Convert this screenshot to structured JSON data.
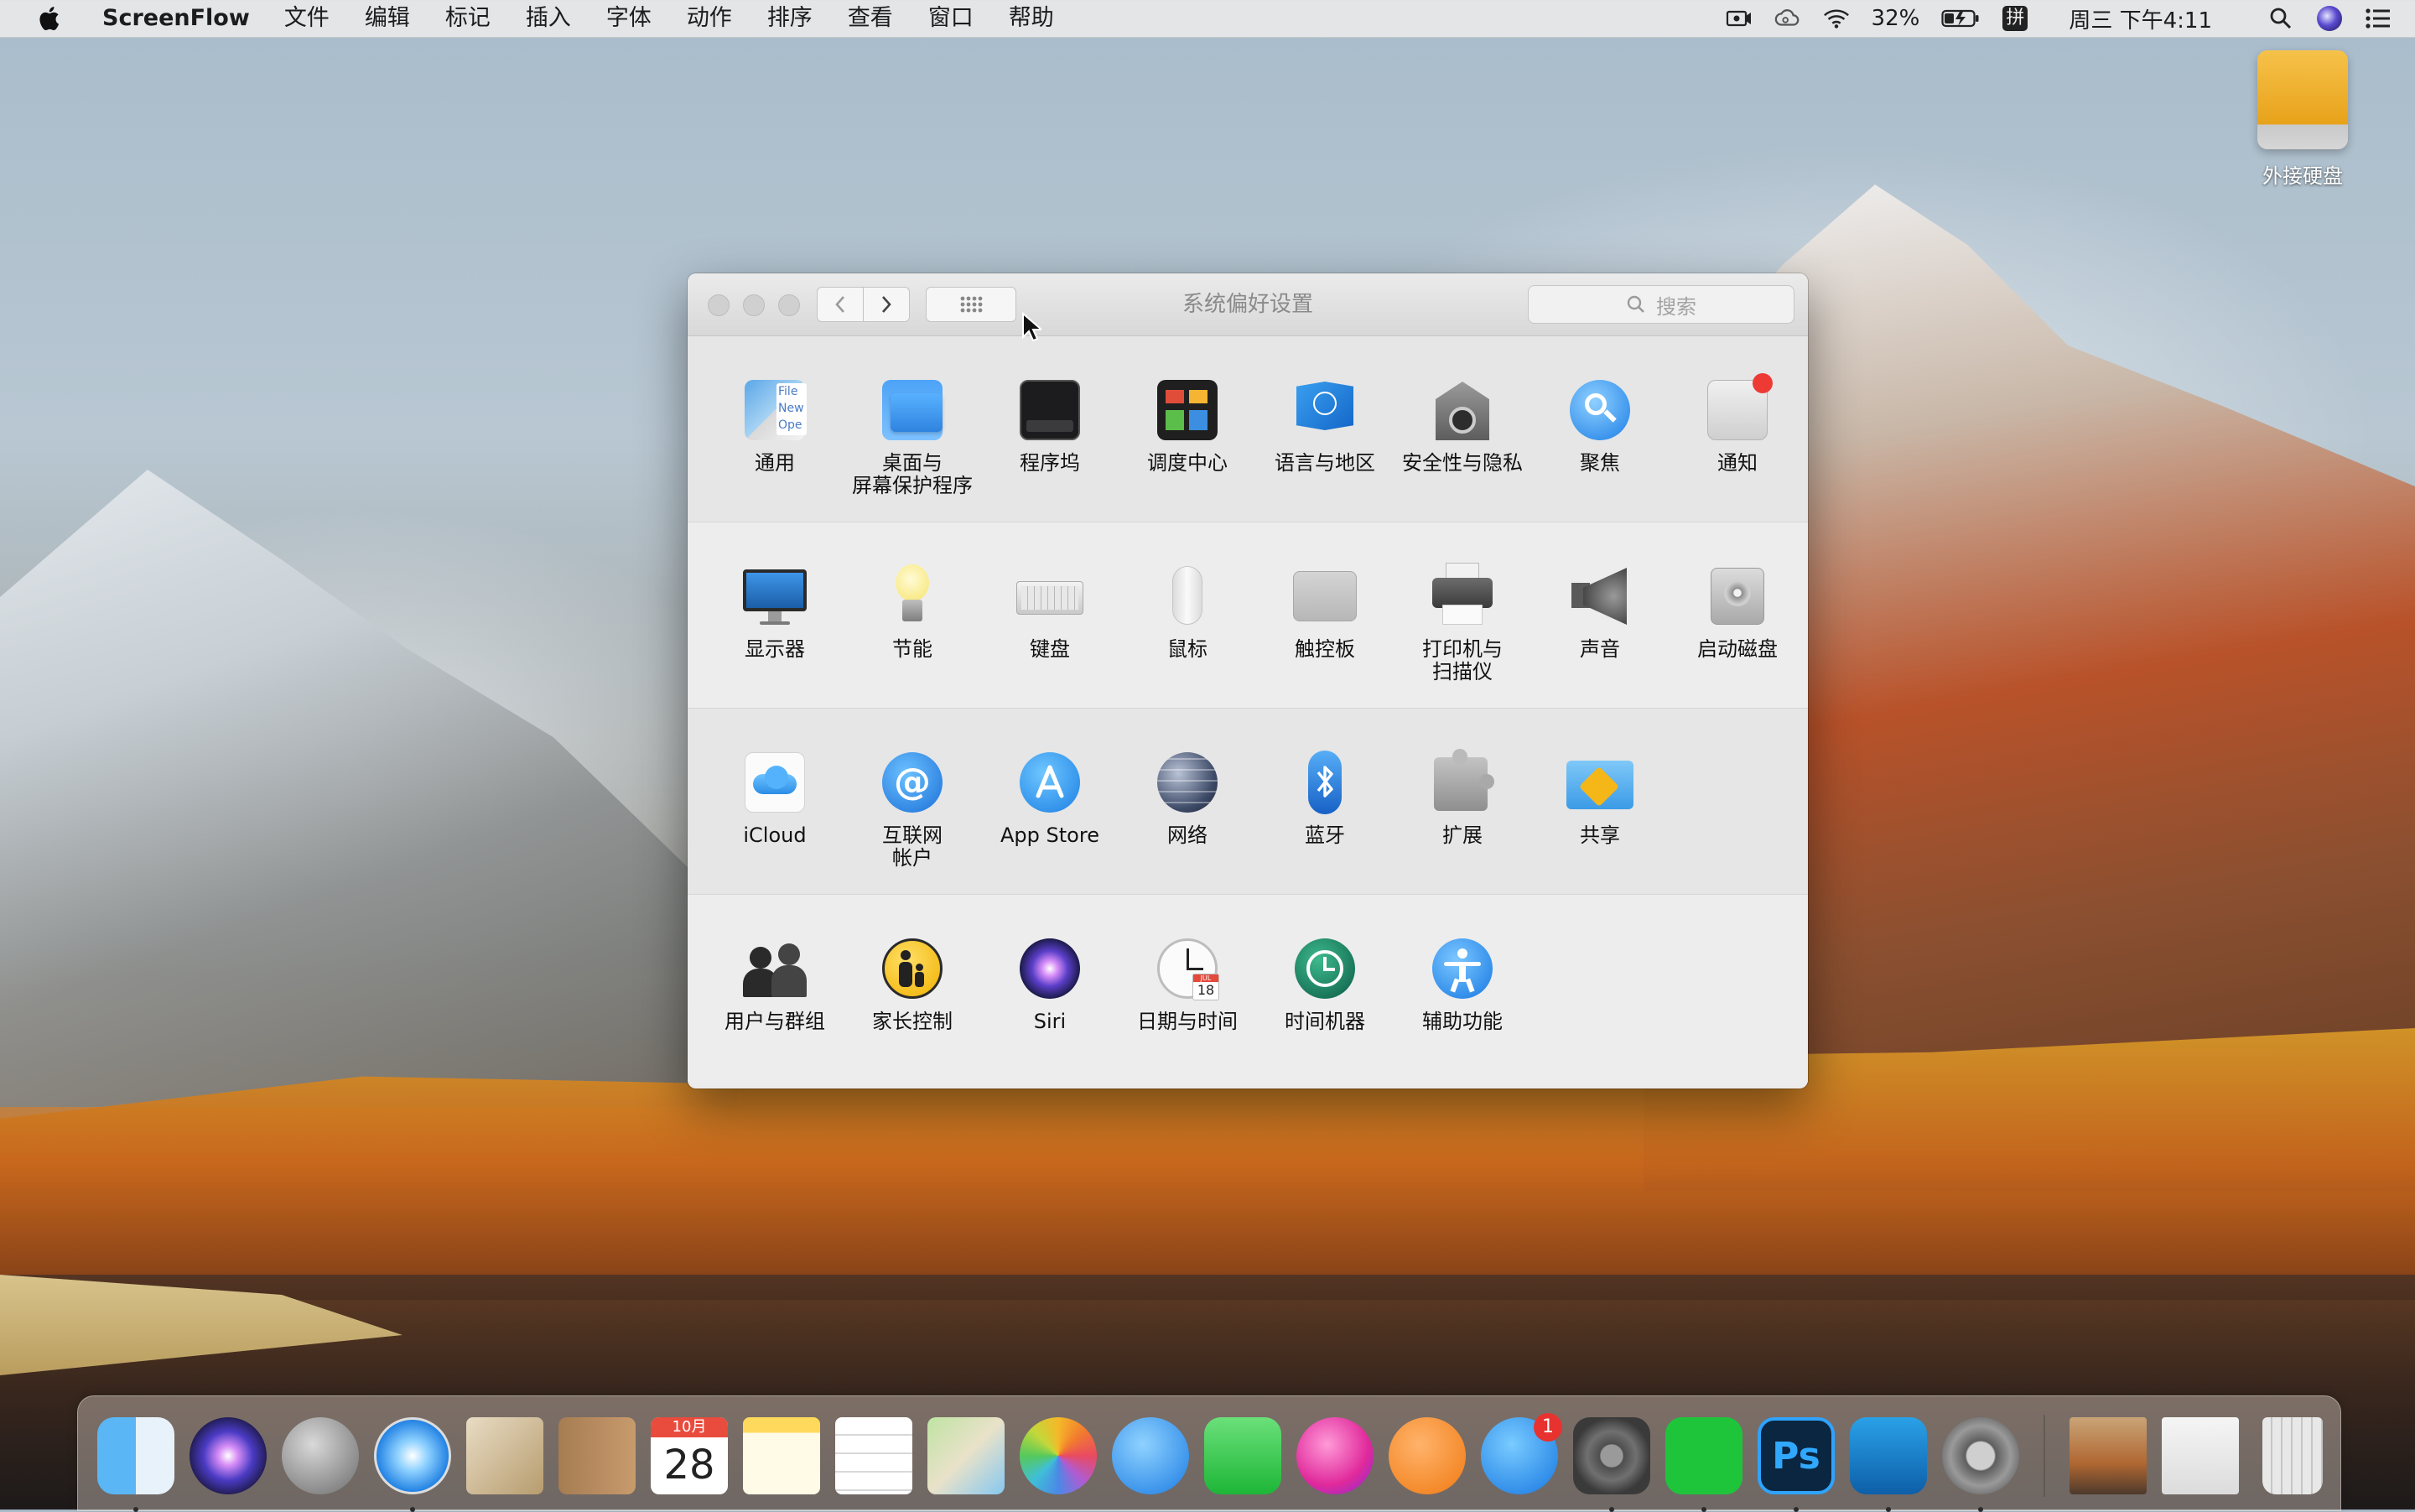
{
  "menubar": {
    "app_name": "ScreenFlow",
    "menus": [
      "文件",
      "编辑",
      "标记",
      "插入",
      "字体",
      "动作",
      "排序",
      "查看",
      "窗口",
      "帮助"
    ],
    "battery_percent": "32%",
    "input_method": "拼",
    "clock": "周三 下午4:11",
    "status_icons": [
      "screen-record-icon",
      "creative-cloud-icon",
      "wifi-icon",
      "battery-icon",
      "input-method-icon",
      "spotlight-icon",
      "siri-icon",
      "notification-center-icon"
    ]
  },
  "desktop": {
    "drive_label": "外接硬盘"
  },
  "window": {
    "title": "系统偏好设置",
    "search_placeholder": "搜索",
    "rows": [
      [
        {
          "label": "通用",
          "icon": "general-icon"
        },
        {
          "label": "桌面与\n屏幕保护程序",
          "icon": "desktop-screensaver-icon"
        },
        {
          "label": "程序坞",
          "icon": "dock-icon"
        },
        {
          "label": "调度中心",
          "icon": "mission-control-icon"
        },
        {
          "label": "语言与地区",
          "icon": "language-region-icon"
        },
        {
          "label": "安全性与隐私",
          "icon": "security-privacy-icon"
        },
        {
          "label": "聚焦",
          "icon": "spotlight-icon"
        },
        {
          "label": "通知",
          "icon": "notifications-icon"
        }
      ],
      [
        {
          "label": "显示器",
          "icon": "displays-icon"
        },
        {
          "label": "节能",
          "icon": "energy-saver-icon"
        },
        {
          "label": "键盘",
          "icon": "keyboard-icon"
        },
        {
          "label": "鼠标",
          "icon": "mouse-icon"
        },
        {
          "label": "触控板",
          "icon": "trackpad-icon"
        },
        {
          "label": "打印机与\n扫描仪",
          "icon": "printers-scanners-icon"
        },
        {
          "label": "声音",
          "icon": "sound-icon"
        },
        {
          "label": "启动磁盘",
          "icon": "startup-disk-icon"
        }
      ],
      [
        {
          "label": "iCloud",
          "icon": "icloud-icon"
        },
        {
          "label": "互联网\n帐户",
          "icon": "internet-accounts-icon"
        },
        {
          "label": "App Store",
          "icon": "app-store-icon"
        },
        {
          "label": "网络",
          "icon": "network-icon"
        },
        {
          "label": "蓝牙",
          "icon": "bluetooth-icon"
        },
        {
          "label": "扩展",
          "icon": "extensions-icon"
        },
        {
          "label": "共享",
          "icon": "sharing-icon"
        }
      ],
      [
        {
          "label": "用户与群组",
          "icon": "users-groups-icon"
        },
        {
          "label": "家长控制",
          "icon": "parental-controls-icon"
        },
        {
          "label": "Siri",
          "icon": "siri-icon"
        },
        {
          "label": "日期与时间",
          "icon": "date-time-icon"
        },
        {
          "label": "时间机器",
          "icon": "time-machine-icon"
        },
        {
          "label": "辅助功能",
          "icon": "accessibility-icon"
        }
      ]
    ],
    "calendar_icon_date": "18",
    "calendar_icon_month": "JUL"
  },
  "dock": {
    "calendar_month": "10月",
    "calendar_day": "28",
    "app_store_badge": "1",
    "items": [
      "finder-icon",
      "siri-icon",
      "launchpad-icon",
      "safari-icon",
      "mail-icon",
      "contacts-icon",
      "calendar-icon",
      "notes-icon",
      "reminders-icon",
      "maps-icon",
      "photos-icon",
      "messages-icon",
      "facetime-icon",
      "itunes-icon",
      "ibooks-icon",
      "app-store-icon",
      "system-preferences-icon",
      "iqiyi-icon",
      "photoshop-icon",
      "screenflow-icon",
      "quicktime-icon"
    ]
  }
}
